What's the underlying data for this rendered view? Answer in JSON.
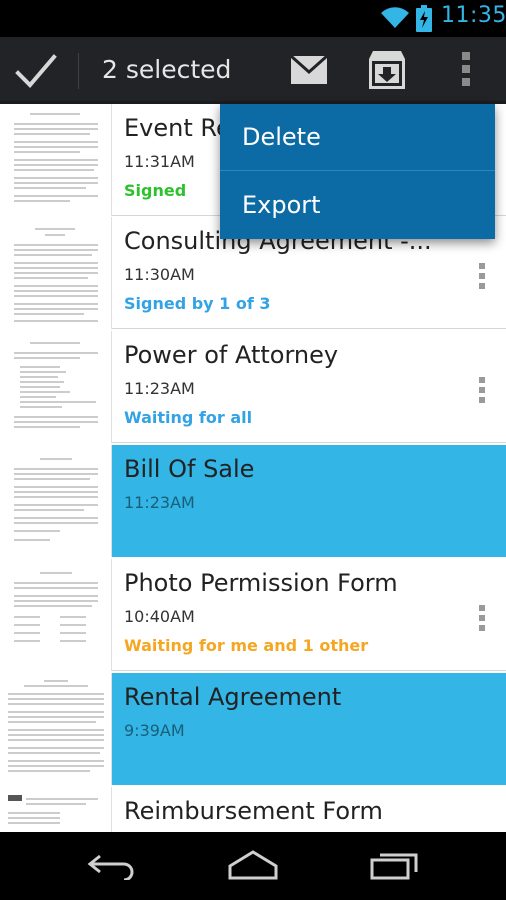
{
  "status_bar": {
    "time": "11:35"
  },
  "action_bar": {
    "title": "2 selected"
  },
  "popup_menu": {
    "items": [
      "Delete",
      "Export"
    ]
  },
  "documents": [
    {
      "title": "Event Re",
      "time": "11:31AM",
      "status": "Signed",
      "status_color": "#2ec12e",
      "selected": false
    },
    {
      "title": "Consulting Agreement -...",
      "time": "11:30AM",
      "status": "Signed by 1 of 3",
      "status_color": "#33a3e5",
      "selected": false
    },
    {
      "title": "Power of Attorney",
      "time": "11:23AM",
      "status": "Waiting for all",
      "status_color": "#33a3e5",
      "selected": false
    },
    {
      "title": "Bill Of Sale",
      "time": "11:23AM",
      "status": "",
      "status_color": "",
      "selected": true
    },
    {
      "title": "Photo Permission Form",
      "time": "10:40AM",
      "status": "Waiting for me and 1 other",
      "status_color": "#f5a623",
      "selected": false
    },
    {
      "title": "Rental Agreement",
      "time": "9:39AM",
      "status": "",
      "status_color": "",
      "selected": true
    },
    {
      "title": "Reimbursement Form",
      "time": "",
      "status": "",
      "status_color": "",
      "selected": false
    }
  ],
  "colors": {
    "accent": "#33b5e5",
    "popup": "#0c6aa4",
    "action_bar": "#222327"
  },
  "icons": [
    "wifi-icon",
    "battery-icon",
    "check-icon",
    "mail-icon",
    "archive-icon",
    "overflow-icon",
    "back-icon",
    "home-icon",
    "recents-icon"
  ]
}
